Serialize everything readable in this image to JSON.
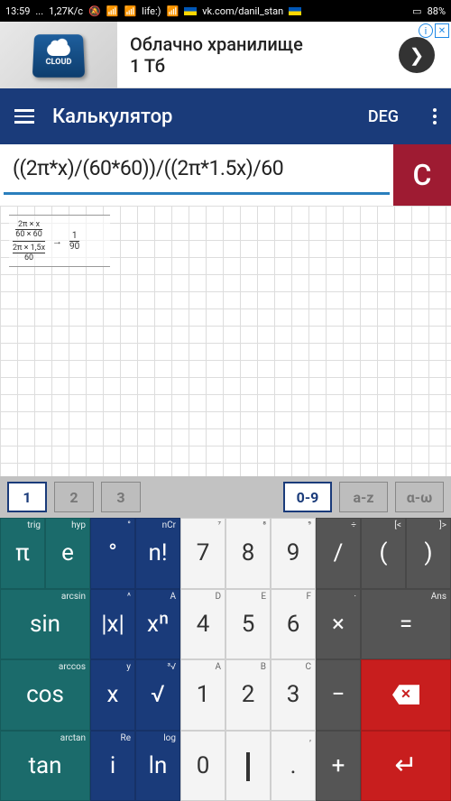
{
  "statusbar": {
    "time": "13:59",
    "speed": "1,27K/c",
    "carrier": "life:)",
    "url": "vk.com/danil_stan",
    "battery": "88%"
  },
  "ad": {
    "title": "Облачно хранилище",
    "subtitle": "1 Тб",
    "key_label": "CLOUD"
  },
  "appbar": {
    "title": "Калькулятор",
    "angle_mode": "DEG"
  },
  "input": {
    "expression": "((2π*x)/(60*60))/((2π*1.5x)/60",
    "clear_label": "C"
  },
  "result": {
    "frac_top_num": "2π × x",
    "frac_top_den": "60 × 60",
    "frac_bot_num": "2π × 1,5x",
    "frac_bot_den": "60",
    "res_num": "1",
    "res_den": "90"
  },
  "palette": {
    "p1": "1",
    "p2": "2",
    "p3": "3",
    "p09": "0-9",
    "paz": "a-z",
    "paw": "α-ω"
  },
  "keys": {
    "pi": "π",
    "pi_sup": "trig",
    "e": "e",
    "e_sup": "hyp",
    "deg": "°",
    "deg_sup": "°",
    "fact": "n!",
    "fact_sup": "nCr",
    "sin": "sin",
    "sin_sup": "arcsin",
    "abs": "|x|",
    "abs_sup": "^",
    "pow": "xⁿ",
    "pow_sup": "A",
    "cos": "cos",
    "cos_sup": "arccos",
    "x": "x",
    "x_sup": "y",
    "sqrt": "√",
    "sqrt_sup": "³√",
    "tan": "tan",
    "tan_sup": "arctan",
    "i": "i",
    "i_sup": "Re",
    "ln": "ln",
    "ln_sup": "log",
    "n7": "7",
    "n7_sup": "⁷",
    "n8": "8",
    "n8_sup": "⁸",
    "n9": "9",
    "n9_sup": "⁹",
    "n4": "4",
    "n4_sup": "D",
    "n5": "5",
    "n5_sup": "E",
    "n6": "6",
    "n6_sup": "F",
    "n1": "1",
    "n1_sup": "A",
    "n2": "2",
    "n2_sup": "B",
    "n3": "3",
    "n3_sup": "C",
    "n0": "0",
    "dot": ".",
    "dot_sup": ",",
    "div": "/",
    "div_sup": "÷",
    "lp": "(",
    "lp_sup": "[<",
    "rp": ")",
    "rp_sup": "]>",
    "mul": "×",
    "mul_sup": "·",
    "eq": "=",
    "eq_sup": "Ans",
    "sub": "−",
    "add": "+"
  }
}
